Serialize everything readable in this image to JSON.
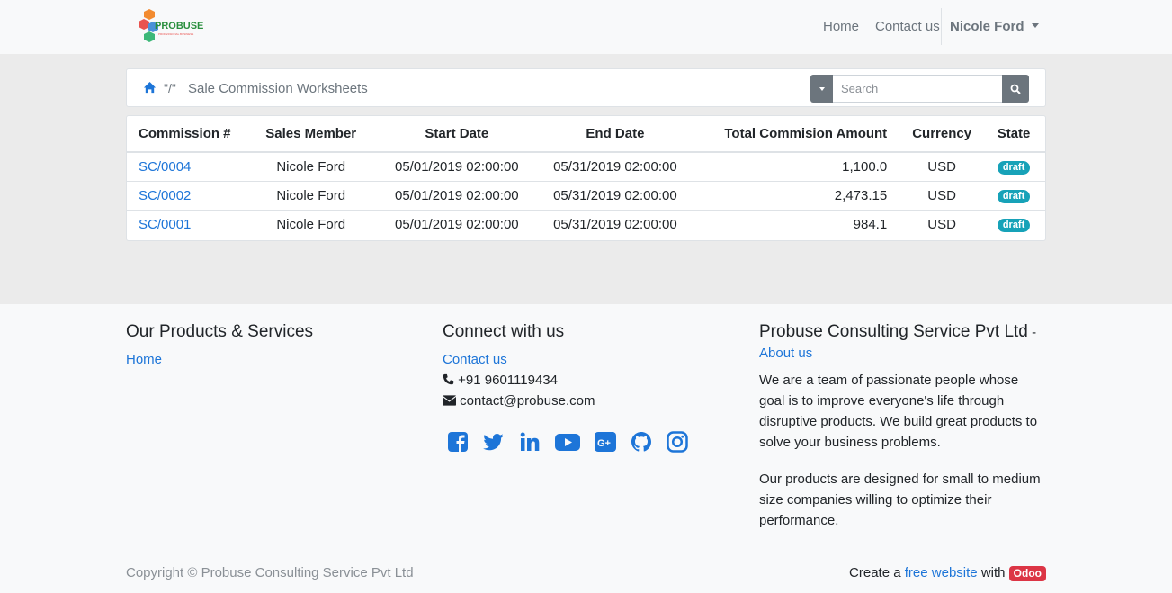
{
  "brand": {
    "name": "PROBUSE",
    "tagline": "PROFESSIONAL BUSINESS"
  },
  "nav": {
    "home": "Home",
    "contact": "Contact us",
    "user": "Nicole Ford"
  },
  "breadcrumb": {
    "separator": "\"/\"",
    "title": "Sale Commission Worksheets"
  },
  "search": {
    "placeholder": "Search"
  },
  "table": {
    "headers": [
      "Commission #",
      "Sales Member",
      "Start Date",
      "End Date",
      "Total Commision Amount",
      "Currency",
      "State"
    ],
    "rows": [
      {
        "number": "SC/0004",
        "member": "Nicole Ford",
        "start": "05/01/2019 02:00:00",
        "end": "05/31/2019 02:00:00",
        "total": "1,100.0",
        "currency": "USD",
        "state": "draft"
      },
      {
        "number": "SC/0002",
        "member": "Nicole Ford",
        "start": "05/01/2019 02:00:00",
        "end": "05/31/2019 02:00:00",
        "total": "2,473.15",
        "currency": "USD",
        "state": "draft"
      },
      {
        "number": "SC/0001",
        "member": "Nicole Ford",
        "start": "05/01/2019 02:00:00",
        "end": "05/31/2019 02:00:00",
        "total": "984.1",
        "currency": "USD",
        "state": "draft"
      }
    ]
  },
  "footer": {
    "products": {
      "heading": "Our Products & Services",
      "home": "Home"
    },
    "connect": {
      "heading": "Connect with us",
      "contact": "Contact us",
      "phone": "+91 9601119434",
      "email": "contact@probuse.com",
      "socials": [
        "facebook-icon",
        "twitter-icon",
        "linkedin-icon",
        "youtube-icon",
        "google-plus-icon",
        "github-icon",
        "instagram-icon"
      ]
    },
    "about": {
      "heading": "Probuse Consulting Service Pvt Ltd",
      "dash": "-",
      "about_link": "About us",
      "p1": "We are a team of passionate people whose goal is to improve everyone's life through disruptive products. We build great products to solve your business problems.",
      "p2": "Our products are designed for small to medium size companies willing to optimize their performance."
    },
    "copyright": "Copyright © Probuse Consulting Service Pvt Ltd",
    "powered": {
      "prefix": "Create a",
      "link": "free website",
      "mid": "with",
      "badge": "Odoo"
    }
  },
  "colors": {
    "link": "#1d75d8",
    "badge_draft": "#17a2b8",
    "odoo": "#dc3545",
    "social": "#1d75d8"
  }
}
